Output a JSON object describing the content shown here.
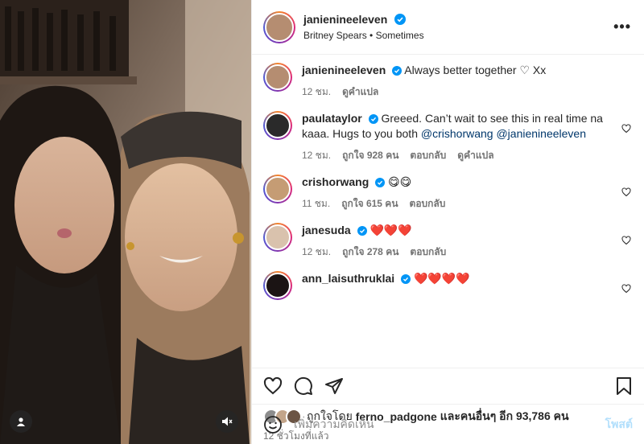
{
  "post": {
    "author": "janienineeleven",
    "audio": "Britney Spears • Sometimes",
    "more_label": "•••"
  },
  "comments": [
    {
      "user": "janienineeleven",
      "text": "Always better together ♡ Xx",
      "time": "12 ชม.",
      "likes": "",
      "reply": "",
      "translate": "ดูคำแปล"
    },
    {
      "user": "paulataylor",
      "text": "Greeed. Can’t wait to see this in real time na kaaa. Hugs to you both",
      "mentions": [
        "@crishorwang",
        "@janienineeleven"
      ],
      "time": "12 ชม.",
      "likes": "ถูกใจ 928 คน",
      "reply": "ตอบกลับ",
      "translate": "ดูคำแปล"
    },
    {
      "user": "crishorwang",
      "text": "😋😋",
      "time": "11 ชม.",
      "likes": "ถูกใจ 615 คน",
      "reply": "ตอบกลับ",
      "translate": ""
    },
    {
      "user": "janesuda",
      "text": "❤️❤️❤️",
      "time": "12 ชม.",
      "likes": "ถูกใจ 278 คน",
      "reply": "ตอบกลับ",
      "translate": ""
    },
    {
      "user": "ann_laisuthruklai",
      "text": "❤️❤️❤️❤️",
      "time": "",
      "likes": "",
      "reply": "",
      "translate": ""
    }
  ],
  "likes_line": {
    "prefix": "ถูกใจโดย",
    "user": "ferno_padgone",
    "suffix": "และคนอื่นๆ อีก 93,786 คน"
  },
  "time_ago": "12 ชั่วโมงที่แล้ว",
  "composer": {
    "placeholder": "เพิ่มความคิดเห็น",
    "post_label": "โพสต์"
  },
  "colors": {
    "link": "#00376b",
    "muted": "#737373",
    "post_disabled": "#b2dffc",
    "heart": "#ed4956"
  }
}
